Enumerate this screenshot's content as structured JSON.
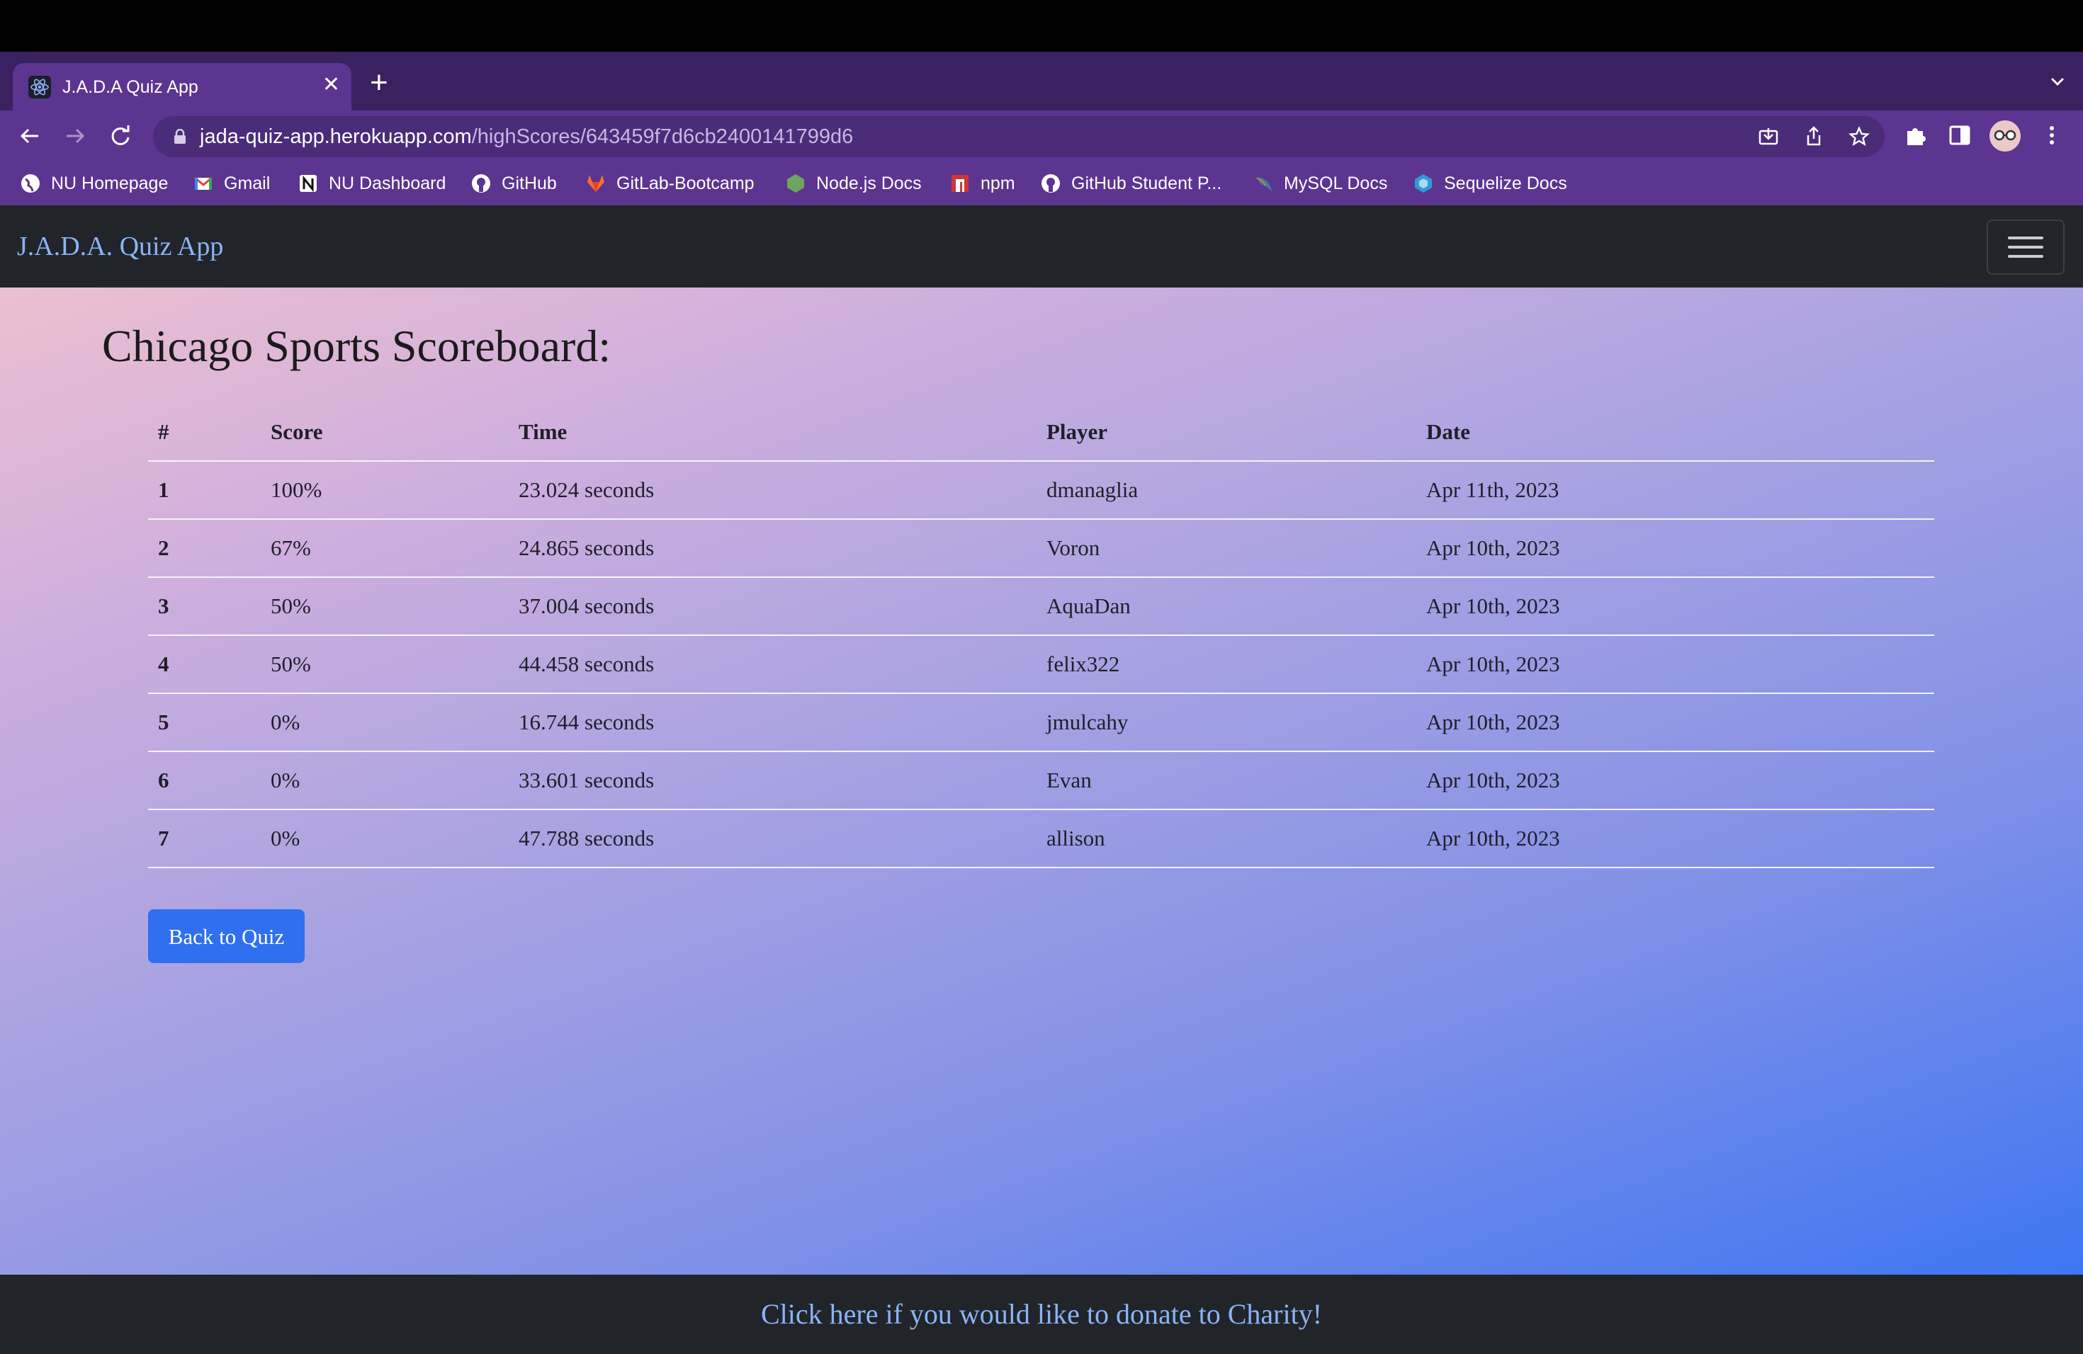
{
  "browser": {
    "tab": {
      "title": "J.A.D.A Quiz App"
    },
    "url": {
      "domain": "jada-quiz-app.herokuapp.com",
      "path": "/highScores/643459f7d6cb2400141799d6"
    },
    "bookmarks": [
      {
        "label": "NU Homepage",
        "icon": "globe-icon"
      },
      {
        "label": "Gmail",
        "icon": "gmail-icon"
      },
      {
        "label": "NU Dashboard",
        "icon": "notion-icon"
      },
      {
        "label": "GitHub",
        "icon": "github-icon"
      },
      {
        "label": "GitLab-Bootcamp",
        "icon": "gitlab-icon"
      },
      {
        "label": "Node.js Docs",
        "icon": "nodejs-icon"
      },
      {
        "label": "npm",
        "icon": "npm-icon"
      },
      {
        "label": "GitHub Student P...",
        "icon": "github-icon"
      },
      {
        "label": "MySQL Docs",
        "icon": "mysql-icon"
      },
      {
        "label": "Sequelize Docs",
        "icon": "sequelize-icon"
      }
    ]
  },
  "navbar": {
    "brand": "J.A.D.A. Quiz App"
  },
  "main": {
    "title": "Chicago Sports Scoreboard:",
    "table": {
      "headers": [
        "#",
        "Score",
        "Time",
        "Player",
        "Date"
      ],
      "rows": [
        [
          "1",
          "100%",
          "23.024 seconds",
          "dmanaglia",
          "Apr 11th, 2023"
        ],
        [
          "2",
          "67%",
          "24.865 seconds",
          "Voron",
          "Apr 10th, 2023"
        ],
        [
          "3",
          "50%",
          "37.004 seconds",
          "AquaDan",
          "Apr 10th, 2023"
        ],
        [
          "4",
          "50%",
          "44.458 seconds",
          "felix322",
          "Apr 10th, 2023"
        ],
        [
          "5",
          "0%",
          "16.744 seconds",
          "jmulcahy",
          "Apr 10th, 2023"
        ],
        [
          "6",
          "0%",
          "33.601 seconds",
          "Evan",
          "Apr 10th, 2023"
        ],
        [
          "7",
          "0%",
          "47.788 seconds",
          "allison",
          "Apr 10th, 2023"
        ]
      ]
    },
    "back_button": "Back to Quiz"
  },
  "footer": {
    "link": "Click here if you would like to donate to Charity!"
  },
  "colors": {
    "brand_link": "#8ab4f8",
    "button": "#2f6ff0",
    "navbar": "#212529",
    "browser_frame": "#5b3590"
  }
}
